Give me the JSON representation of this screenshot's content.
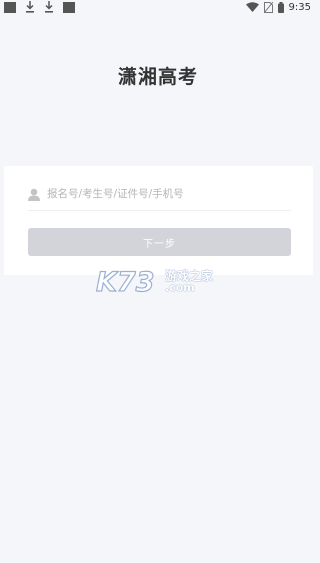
{
  "status_bar": {
    "time": "9:35",
    "icons": [
      "notification-square-icon",
      "download-icon",
      "download-icon",
      "notification-square-icon",
      "wifi-icon",
      "no-sim-icon",
      "battery-icon"
    ]
  },
  "app": {
    "title": "潇湘高考"
  },
  "login": {
    "input_placeholder": "报名号/考生号/证件号/手机号",
    "input_value": "",
    "next_button_label": "下一步"
  },
  "watermark": {
    "logo_text": "K73",
    "name": "游戏之家",
    "domain": ".com"
  },
  "colors": {
    "background": "#f5f6fa",
    "card": "#ffffff",
    "button_disabled": "#d3d4d9",
    "title_text": "#333333",
    "placeholder": "#b5b5b5"
  }
}
